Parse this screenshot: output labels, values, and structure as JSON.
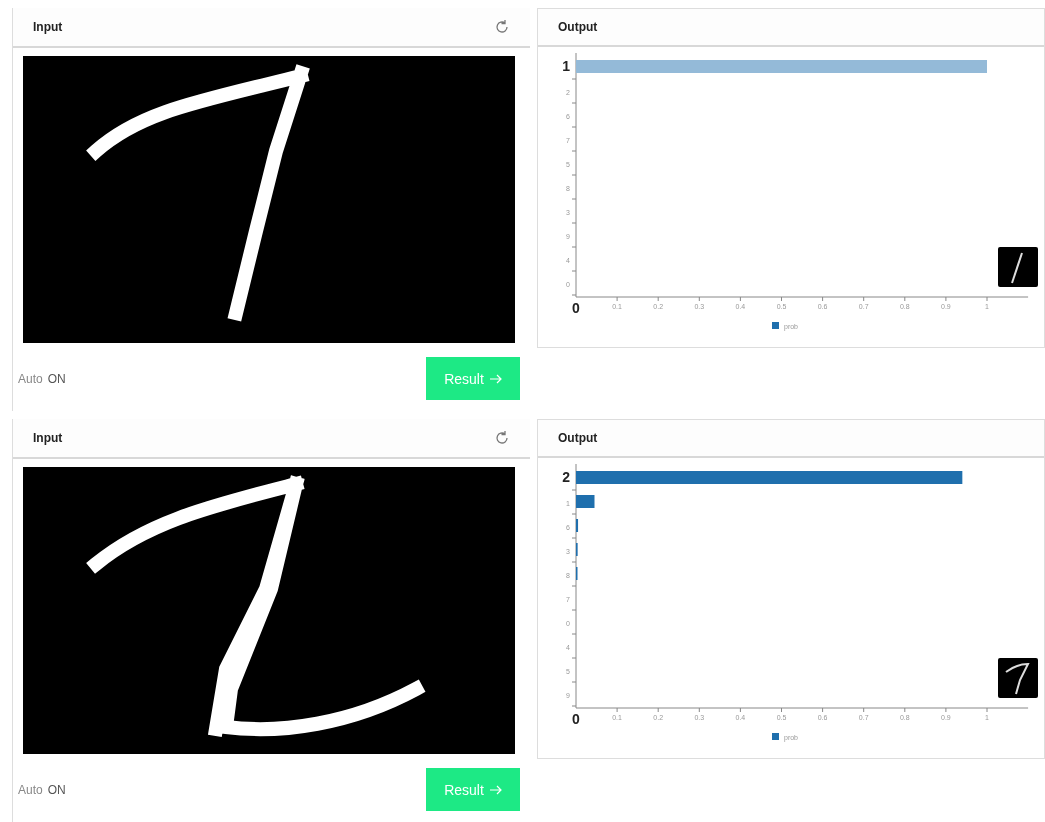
{
  "panels": [
    {
      "input": {
        "title": "Input"
      },
      "output": {
        "title": "Output",
        "chart_data": {
          "type": "bar",
          "orientation": "horizontal",
          "categories": [
            "1",
            "2",
            "6",
            "7",
            "5",
            "8",
            "3",
            "9",
            "4",
            "0"
          ],
          "series": [
            {
              "name": "prob",
              "color": "#94bad8",
              "values": [
                1,
                0,
                0,
                0,
                0,
                0,
                0,
                0,
                0,
                0
              ]
            }
          ],
          "xlim": [
            0,
            1.1
          ],
          "xticks": [
            0.1,
            0.2,
            0.3,
            0.4,
            0.5,
            0.6,
            0.7,
            0.8,
            0.9,
            1
          ]
        },
        "origin_label": "0"
      },
      "auto": {
        "label": "Auto",
        "state": "ON"
      },
      "result_button": "Result"
    },
    {
      "input": {
        "title": "Input"
      },
      "output": {
        "title": "Output",
        "chart_data": {
          "type": "bar",
          "orientation": "horizontal",
          "categories": [
            "2",
            "1",
            "6",
            "3",
            "8",
            "7",
            "0",
            "4",
            "5",
            "9"
          ],
          "series": [
            {
              "name": "prob",
              "color": "#1f6fad",
              "values": [
                0.94,
                0.045,
                0.005,
                0.004,
                0.001,
                0,
                0,
                0,
                0,
                0
              ]
            }
          ],
          "xlim": [
            0,
            1.1
          ],
          "xticks": [
            0.1,
            0.2,
            0.3,
            0.4,
            0.5,
            0.6,
            0.7,
            0.8,
            0.9,
            1
          ]
        },
        "origin_label": "0"
      },
      "auto": {
        "label": "Auto",
        "state": "ON"
      },
      "result_button": "Result"
    }
  ]
}
